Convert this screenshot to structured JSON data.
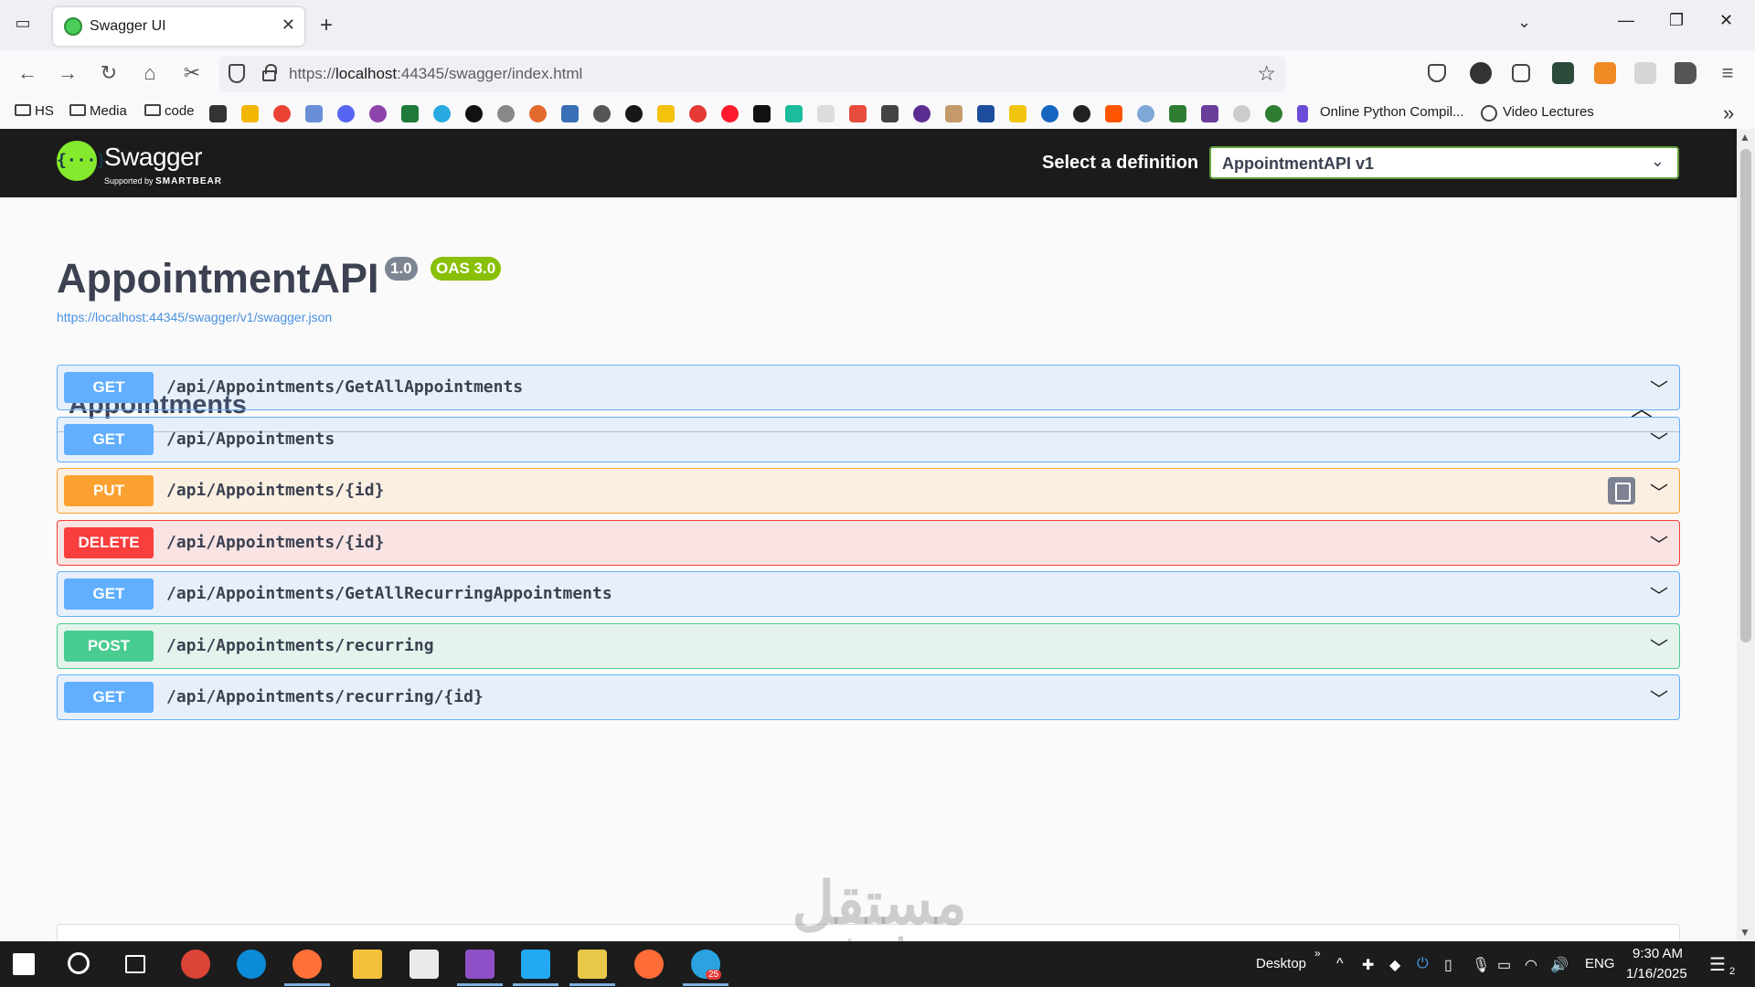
{
  "browser": {
    "tab_title": "Swagger UI",
    "new_tab": "+",
    "url_prefix": "https://",
    "url_host": "localhost",
    "url_rest": ":44345/swagger/index.html",
    "bookmark_folders": [
      "HS",
      "Media",
      "code"
    ],
    "bookmark_links": [
      "Online Python Compil...",
      "Video Lectures"
    ]
  },
  "swagger": {
    "brand": "Swagger",
    "supported_by": "Supported by",
    "smartbear": "SMARTBEAR",
    "select_label": "Select a definition",
    "selected_definition": "AppointmentAPI v1",
    "api_title": "AppointmentAPI",
    "version_badge": "1.0",
    "oas_badge": "OAS 3.0",
    "spec_url": "https://localhost:44345/swagger/v1/swagger.json",
    "tag": "Appointments",
    "operations": [
      {
        "method": "GET",
        "path": "/api/Appointments/GetAllAppointments"
      },
      {
        "method": "GET",
        "path": "/api/Appointments"
      },
      {
        "method": "PUT",
        "path": "/api/Appointments/{id}"
      },
      {
        "method": "DELETE",
        "path": "/api/Appointments/{id}"
      },
      {
        "method": "GET",
        "path": "/api/Appointments/GetAllRecurringAppointments"
      },
      {
        "method": "POST",
        "path": "/api/Appointments/recurring"
      },
      {
        "method": "GET",
        "path": "/api/Appointments/recurring/{id}"
      }
    ],
    "method_colors": {
      "GET": "#61affe",
      "PUT": "#fca130",
      "DELETE": "#f93e3e",
      "POST": "#49cc90"
    }
  },
  "watermark": {
    "arabic": "مستقل",
    "latin": "mostaql.com"
  },
  "taskbar": {
    "desktop_label": "Desktop",
    "language": "ENG",
    "time": "9:30 AM",
    "date": "1/16/2025",
    "notification_count": "2",
    "badge_count": "25"
  }
}
